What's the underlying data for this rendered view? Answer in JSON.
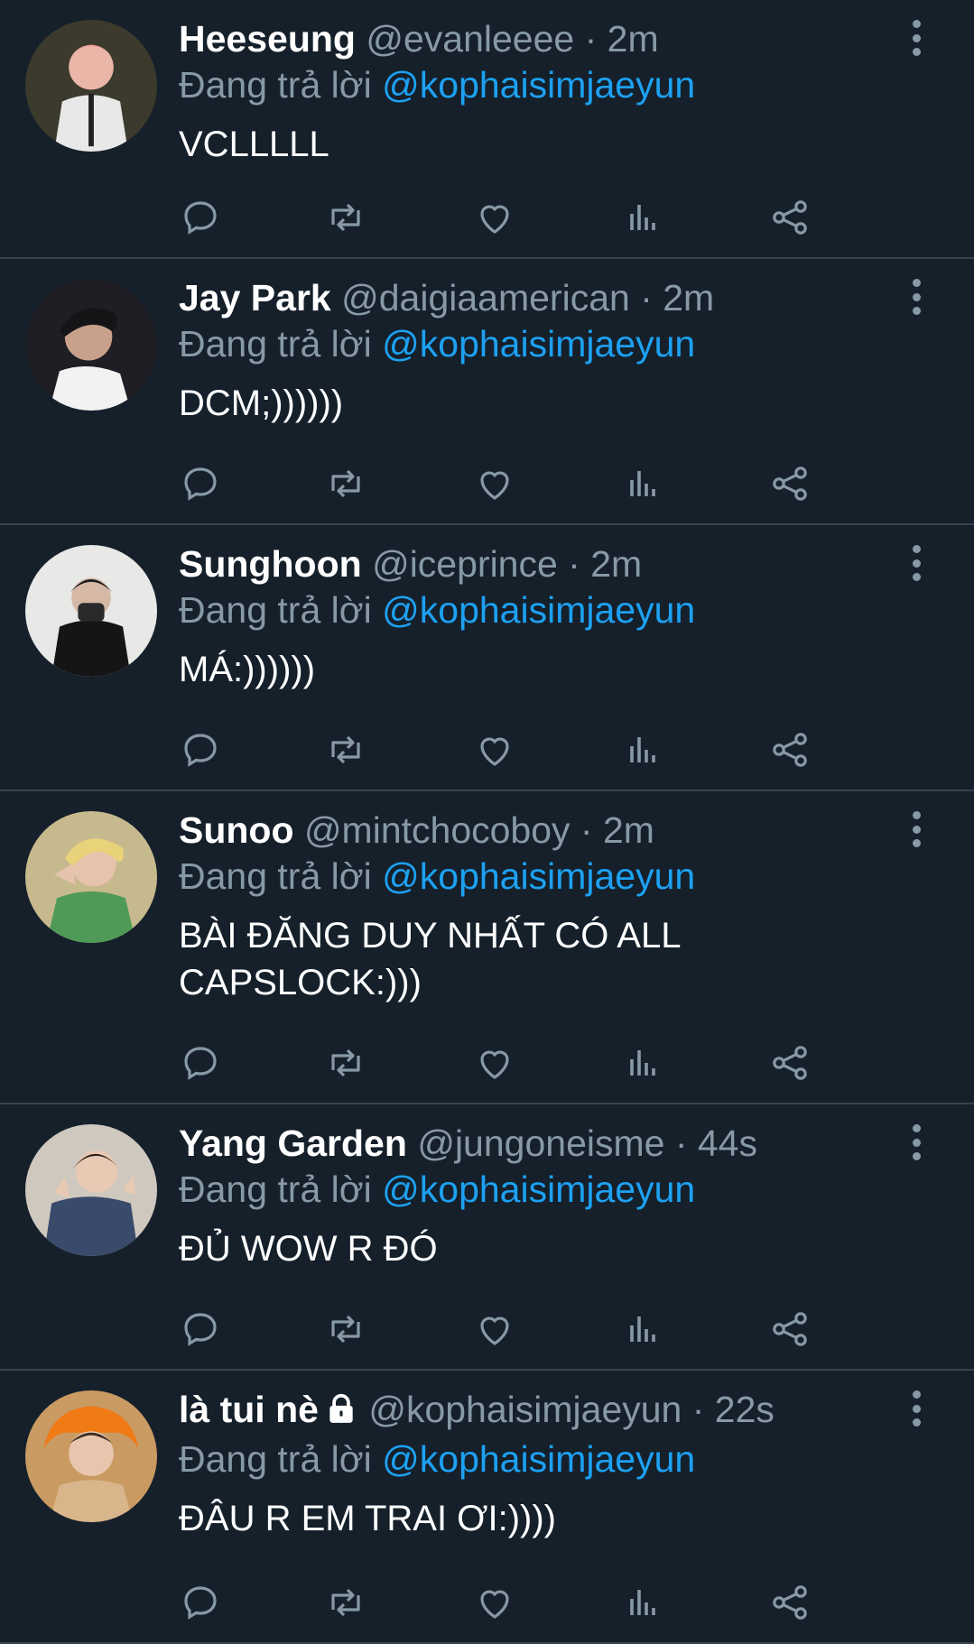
{
  "reply_prefix": "Đang trả lời",
  "colors": {
    "background": "#15202b",
    "secondary": "#8899a6",
    "accent": "#1da1f2",
    "divider": "#38444d"
  },
  "action_icons": [
    "reply-icon",
    "retweet-icon",
    "like-icon",
    "analytics-icon",
    "share-icon"
  ],
  "tweets": [
    {
      "name": "Heeseung",
      "handle": "@evanleeee",
      "time": "2m",
      "reply_to": "@kophaisimjaeyun",
      "text": "VCLLLLL"
    },
    {
      "name": "Jay Park",
      "handle": "@daigiaamerican",
      "time": "2m",
      "reply_to": "@kophaisimjaeyun",
      "text": "DCM;))))))"
    },
    {
      "name": "Sunghoon",
      "handle": "@iceprince",
      "time": "2m",
      "reply_to": "@kophaisimjaeyun",
      "text": "MÁ:))))))"
    },
    {
      "name": "Sunoo",
      "handle": "@mintchocoboy",
      "time": "2m",
      "reply_to": "@kophaisimjaeyun",
      "text": "BÀI ĐĂNG DUY NHẤT CÓ ALL CAPSLOCK:)))"
    },
    {
      "name": "Yang Garden",
      "handle": "@jungoneisme",
      "time": "44s",
      "reply_to": "@kophaisimjaeyun",
      "text": "ĐỦ WOW R ĐÓ"
    },
    {
      "name": "là tui nè",
      "handle": "@kophaisimjaeyun",
      "time": "22s",
      "reply_to": "@kophaisimjaeyun",
      "text": "ĐÂU R EM TRAI ƠI:))))",
      "locked": true
    }
  ]
}
